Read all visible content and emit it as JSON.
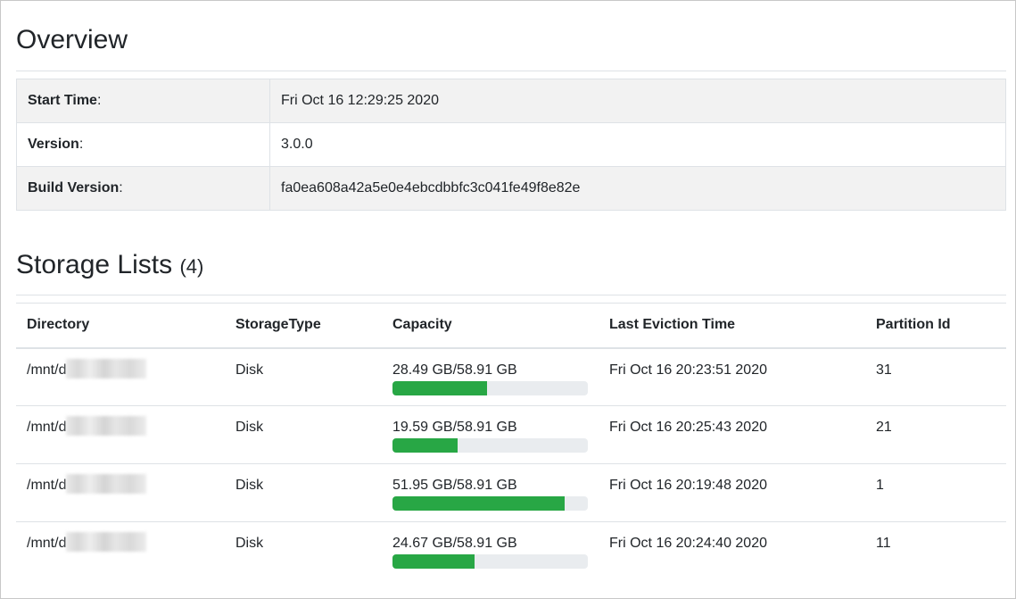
{
  "overview": {
    "title": "Overview",
    "rows": [
      {
        "key": "Start Time",
        "value": "Fri Oct 16 12:29:25 2020"
      },
      {
        "key": "Version",
        "value": "3.0.0"
      },
      {
        "key": "Build Version",
        "value": "fa0ea608a42a5e0e4ebcdbbfc3c041fe49f8e82e"
      }
    ]
  },
  "storage": {
    "title": "Storage Lists",
    "count": "(4)",
    "headers": [
      "Directory",
      "StorageType",
      "Capacity",
      "Last Eviction Time",
      "Partition Id"
    ],
    "rows": [
      {
        "directory": "/mnt/d",
        "type": "Disk",
        "capacity": "28.49 GB/58.91 GB",
        "used_fraction": 0.4836,
        "eviction": "Fri Oct 16 20:23:51 2020",
        "partition": "31"
      },
      {
        "directory": "/mnt/d",
        "type": "Disk",
        "capacity": "19.59 GB/58.91 GB",
        "used_fraction": 0.3325,
        "eviction": "Fri Oct 16 20:25:43 2020",
        "partition": "21"
      },
      {
        "directory": "/mnt/d",
        "type": "Disk",
        "capacity": "51.95 GB/58.91 GB",
        "used_fraction": 0.8819,
        "eviction": "Fri Oct 16 20:19:48 2020",
        "partition": "1"
      },
      {
        "directory": "/mnt/d",
        "type": "Disk",
        "capacity": "24.67 GB/58.91 GB",
        "used_fraction": 0.4188,
        "eviction": "Fri Oct 16 20:24:40 2020",
        "partition": "11"
      }
    ]
  },
  "colors": {
    "progress_fill": "#28a745",
    "progress_track": "#e9ecef",
    "striped_row": "#f2f2f2"
  }
}
